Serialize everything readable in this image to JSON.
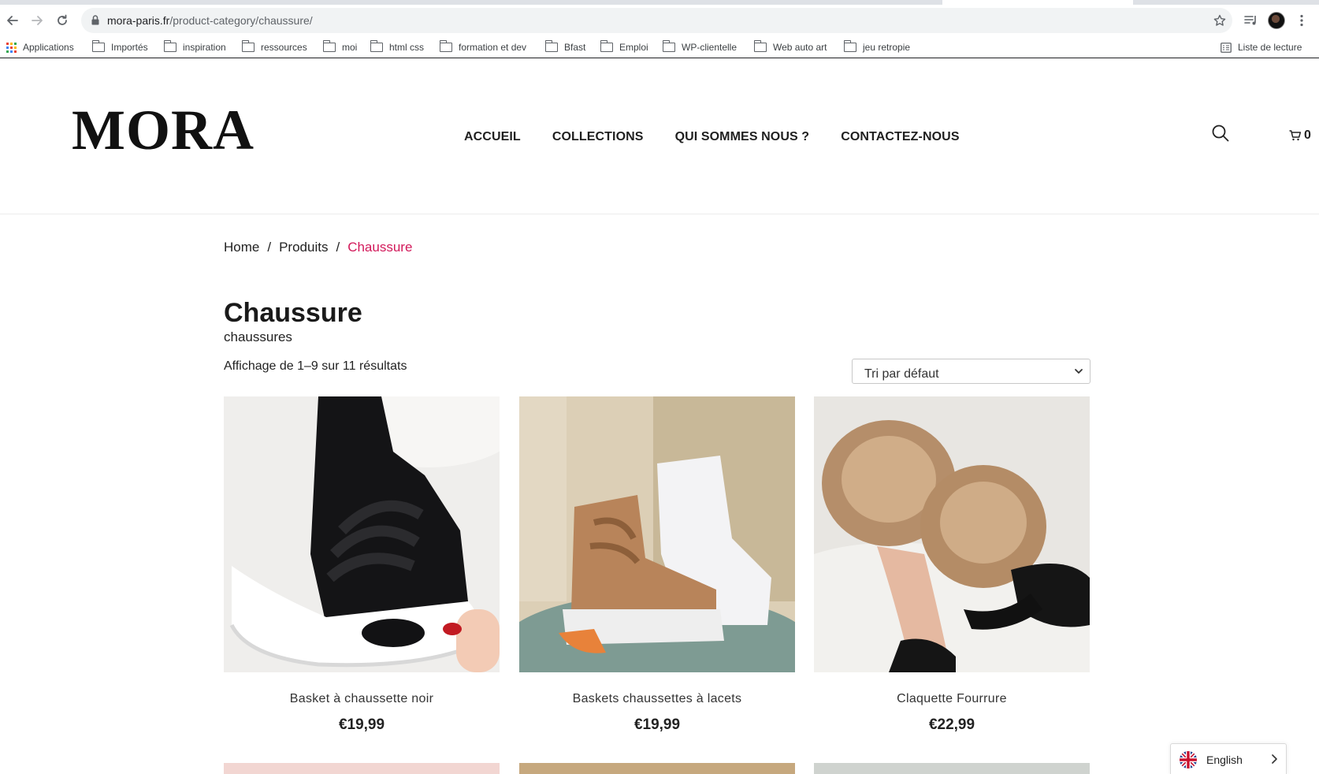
{
  "browser": {
    "url_host": "mora-paris.fr",
    "url_path": "/product-category/chaussure/",
    "bookmarks": [
      {
        "label": "Applications",
        "icon": "apps-grid-icon"
      },
      {
        "label": "Importés",
        "icon": "folder-icon"
      },
      {
        "label": "inspiration",
        "icon": "folder-icon"
      },
      {
        "label": "ressources",
        "icon": "folder-icon"
      },
      {
        "label": "moi",
        "icon": "folder-icon"
      },
      {
        "label": "html css",
        "icon": "folder-icon"
      },
      {
        "label": "formation et dev",
        "icon": "folder-icon"
      },
      {
        "label": "Bfast",
        "icon": "folder-icon"
      },
      {
        "label": "Emploi",
        "icon": "folder-icon"
      },
      {
        "label": "WP-clientelle",
        "icon": "folder-icon"
      },
      {
        "label": "Web auto art",
        "icon": "folder-icon"
      },
      {
        "label": "jeu retropie",
        "icon": "folder-icon"
      }
    ],
    "reading_list": "Liste de lecture"
  },
  "site": {
    "logo": "MORA",
    "nav": [
      "ACCUEIL",
      "COLLECTIONS",
      "QUI SOMMES NOUS ?",
      "CONTACTEZ-NOUS"
    ],
    "cart_count": "0",
    "accent_color": "#d2195a"
  },
  "breadcrumb": {
    "home": "Home",
    "sep": "/",
    "products": "Produits",
    "current": "Chaussure"
  },
  "category": {
    "title": "Chaussure",
    "description": "chaussures",
    "result_count": "Affichage de 1–9 sur 11 résultats",
    "sort_selected": "Tri par défaut"
  },
  "products": [
    {
      "name": "Basket à chaussette noir",
      "price": "€19,99"
    },
    {
      "name": "Baskets chaussettes à lacets",
      "price": "€19,99"
    },
    {
      "name": "Claquette Fourrure",
      "price": "€22,99"
    }
  ],
  "language": {
    "label": "English"
  }
}
